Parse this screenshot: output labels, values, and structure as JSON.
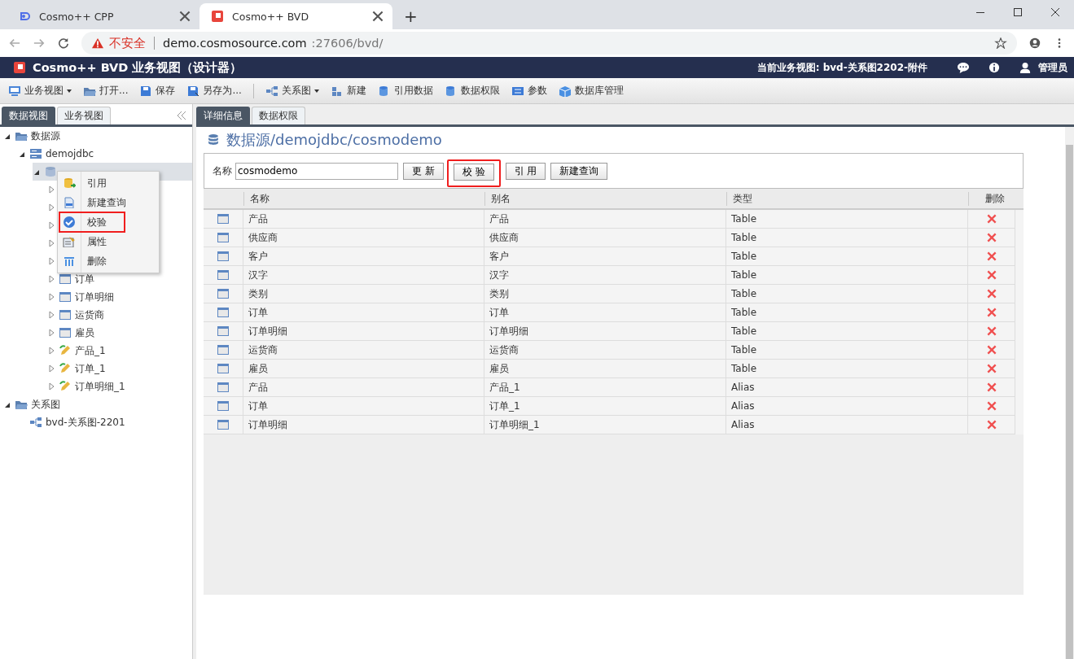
{
  "browser": {
    "tabs": [
      {
        "title": "Cosmo++ CPP",
        "selected": false
      },
      {
        "title": "Cosmo++ BVD",
        "selected": true
      }
    ],
    "new_tab": "+",
    "security": "不安全",
    "url_host": "demo.cosmosource.com",
    "url_path": ":27606/bvd/"
  },
  "app_bar": {
    "title": "Cosmo++ BVD 业务视图（设计器）",
    "current_view": "当前业务视图: bvd-关系图2202-附件",
    "user": "管理员"
  },
  "toolbar": [
    {
      "kind": "menu",
      "label": "业务视图"
    },
    {
      "kind": "button",
      "label": "打开..."
    },
    {
      "kind": "button",
      "label": "保存"
    },
    {
      "kind": "button",
      "label": "另存为..."
    },
    {
      "kind": "divider"
    },
    {
      "kind": "menu",
      "label": "关系图"
    },
    {
      "kind": "button",
      "label": "新建"
    },
    {
      "kind": "button",
      "label": "引用数据"
    },
    {
      "kind": "button",
      "label": "数据权限"
    },
    {
      "kind": "button",
      "label": "参数"
    },
    {
      "kind": "button",
      "label": "数据库管理"
    }
  ],
  "left_panel": {
    "tabs": [
      {
        "label": "数据视图",
        "selected": true
      },
      {
        "label": "业务视图",
        "selected": false
      }
    ],
    "tree": [
      {
        "kind": "folder",
        "label": "数据源",
        "expanded": true,
        "selected": false,
        "children": [
          {
            "kind": "server",
            "label": "demojdbc",
            "expanded": true,
            "selected": false,
            "children": [
              {
                "kind": "database",
                "expanded": true,
                "selected": true,
                "children": [
                  {
                    "kind": "table",
                    "expanded": false,
                    "selected": false
                  },
                  {
                    "kind": "table",
                    "expanded": false,
                    "selected": false
                  },
                  {
                    "kind": "table",
                    "expanded": false,
                    "selected": false
                  },
                  {
                    "kind": "table",
                    "expanded": false,
                    "selected": false
                  },
                  {
                    "kind": "table",
                    "expanded": false,
                    "selected": false
                  },
                  {
                    "kind": "table",
                    "label": "订单",
                    "expanded": false,
                    "selected": false
                  },
                  {
                    "kind": "table",
                    "label": "订单明细",
                    "expanded": false,
                    "selected": false
                  },
                  {
                    "kind": "table",
                    "label": "运货商",
                    "expanded": false,
                    "selected": false
                  },
                  {
                    "kind": "table",
                    "label": "雇员",
                    "expanded": false,
                    "selected": false
                  },
                  {
                    "kind": "alias",
                    "label": "产品_1",
                    "expanded": false,
                    "selected": false
                  },
                  {
                    "kind": "alias",
                    "label": "订单_1",
                    "expanded": false,
                    "selected": false
                  },
                  {
                    "kind": "alias",
                    "label": "订单明细_1",
                    "expanded": false,
                    "selected": false
                  }
                ]
              }
            ]
          }
        ]
      },
      {
        "kind": "folder",
        "label": "关系图",
        "expanded": true,
        "selected": false,
        "children": [
          {
            "kind": "diagram",
            "label": "bvd-关系图-2201",
            "selected": false
          }
        ]
      }
    ],
    "context_menu": [
      {
        "label": "引用",
        "highlighted": false
      },
      {
        "label": "新建查询",
        "highlighted": false
      },
      {
        "label": "校验",
        "highlighted": true
      },
      {
        "label": "属性",
        "highlighted": false
      },
      {
        "label": "删除",
        "highlighted": false
      }
    ]
  },
  "right_panel": {
    "tabs": [
      {
        "label": "详细信息",
        "selected": true
      },
      {
        "label": "数据权限",
        "selected": false
      }
    ],
    "heading": "数据源/demojdbc/cosmodemo",
    "name_label": "名称",
    "name_value": "cosmodemo",
    "buttons": [
      {
        "label": "更 新",
        "highlighted": false
      },
      {
        "label": "校 验",
        "highlighted": true
      },
      {
        "label": "引 用",
        "highlighted": false
      },
      {
        "label": "新建查询",
        "highlighted": false
      }
    ],
    "table": {
      "columns": [
        "名称",
        "别名",
        "类型",
        "删除"
      ],
      "rows": [
        {
          "name": "产品",
          "alias": "产品",
          "type": "Table"
        },
        {
          "name": "供应商",
          "alias": "供应商",
          "type": "Table"
        },
        {
          "name": "客户",
          "alias": "客户",
          "type": "Table"
        },
        {
          "name": "汉字",
          "alias": "汉字",
          "type": "Table"
        },
        {
          "name": "类别",
          "alias": "类别",
          "type": "Table"
        },
        {
          "name": "订单",
          "alias": "订单",
          "type": "Table"
        },
        {
          "name": "订单明细",
          "alias": "订单明细",
          "type": "Table"
        },
        {
          "name": "运货商",
          "alias": "运货商",
          "type": "Table"
        },
        {
          "name": "雇员",
          "alias": "雇员",
          "type": "Table"
        },
        {
          "name": "产品",
          "alias": "产品_1",
          "type": "Alias"
        },
        {
          "name": "订单",
          "alias": "订单_1",
          "type": "Alias"
        },
        {
          "name": "订单明细",
          "alias": "订单明细_1",
          "type": "Alias"
        }
      ]
    }
  }
}
